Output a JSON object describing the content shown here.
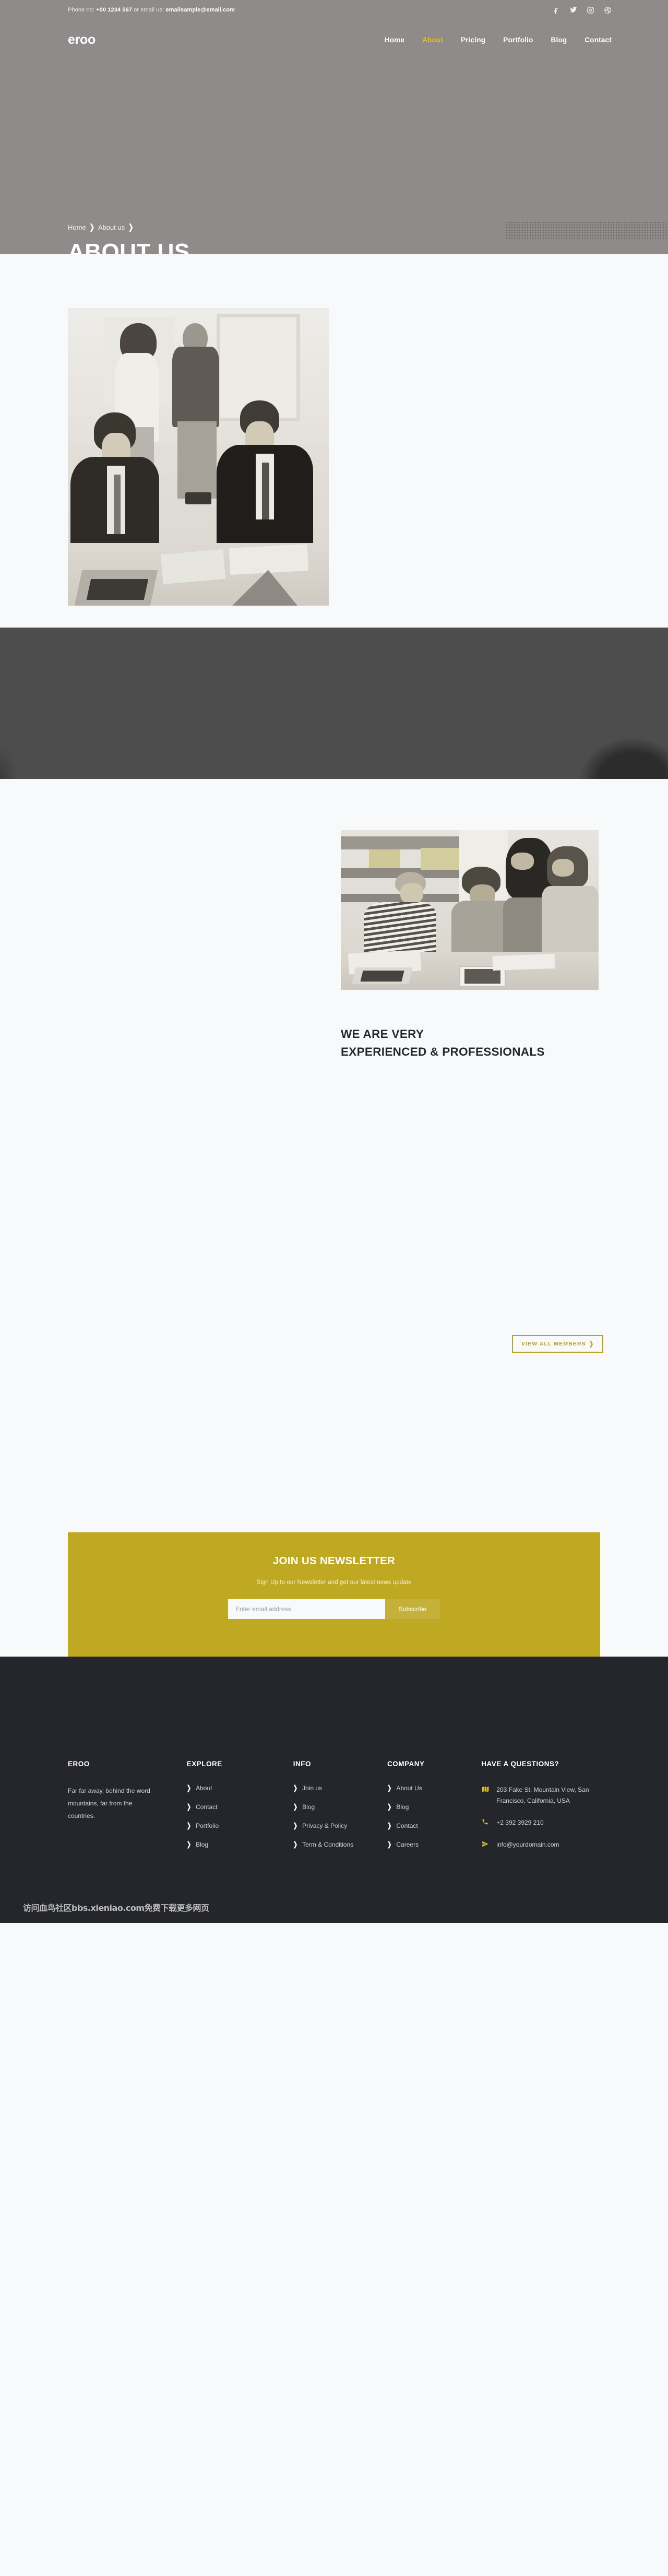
{
  "topbar": {
    "contact_prefix": "Phone no: ",
    "phone": "+00 1234 567",
    "contact_middle": " or email us: ",
    "email": "emailsample@email.com",
    "socials": [
      {
        "name": "facebook-icon",
        "label": "Facebook"
      },
      {
        "name": "twitter-icon",
        "label": "Twitter"
      },
      {
        "name": "instagram-icon",
        "label": "Instagram"
      },
      {
        "name": "dribbble-icon",
        "label": "Dribbble"
      }
    ]
  },
  "navbar": {
    "brand": "eroo",
    "links": [
      {
        "label": "Home",
        "active": false
      },
      {
        "label": "About",
        "active": true
      },
      {
        "label": "Pricing",
        "active": false
      },
      {
        "label": "Portfolio",
        "active": false
      },
      {
        "label": "Blog",
        "active": false
      },
      {
        "label": "Contact",
        "active": false
      }
    ]
  },
  "hero": {
    "breadcrumb": [
      {
        "label": "Home"
      },
      {
        "label": "About us"
      }
    ],
    "separator": "❯",
    "title": "ABOUT US"
  },
  "experience": {
    "heading_line1": "WE ARE VERY",
    "heading_line2": "EXPERIENCED & PROFESSIONALS",
    "cta_label": "VIEW ALL MEMBERS",
    "cta_chevron": "❯"
  },
  "newsletter": {
    "title": "JOIN US NEWSLETTER",
    "subtitle": "Sign Up to our Newsletter and get our latest news update",
    "input_placeholder": "Enter email address",
    "input_value": "",
    "button_label": "Subscribe"
  },
  "footer": {
    "columns": [
      {
        "title": "EROO",
        "type": "text",
        "text": "Far far away, behind the word mountains, far from the countries."
      },
      {
        "title": "EXPLORE",
        "type": "links",
        "links": [
          "About",
          "Contact",
          "Portfolio",
          "Blog"
        ]
      },
      {
        "title": "INFO",
        "type": "links",
        "links": [
          "Join us",
          "Blog",
          "Privacy & Policy",
          "Term & Conditions"
        ]
      },
      {
        "title": "COMPANY",
        "type": "links",
        "links": [
          "About Us",
          "Blog",
          "Contact",
          "Careers"
        ]
      }
    ],
    "contact": {
      "title": "HAVE A QUESTIONS?",
      "items": [
        {
          "icon": "map-icon",
          "text": "203 Fake St. Mountain View, San Francisco, California, USA"
        },
        {
          "icon": "phone-icon",
          "text": "+2 392 3929 210"
        },
        {
          "icon": "send-icon",
          "text": "info@yourdomain.com"
        }
      ]
    },
    "link_chevron": "❯",
    "watermark": "访问血鸟社区bbs.xieniao.com免费下载更多网页"
  },
  "colors": {
    "accent": "#bfa923",
    "accent_text": "#b8a11d",
    "nav_active": "#e3bd1a",
    "hero_bg": "#908b8b",
    "dark_band": "#4d4d4d",
    "footer_bg": "#24262b",
    "page_bg": "#f8f9fa",
    "heading": "#26282c"
  }
}
